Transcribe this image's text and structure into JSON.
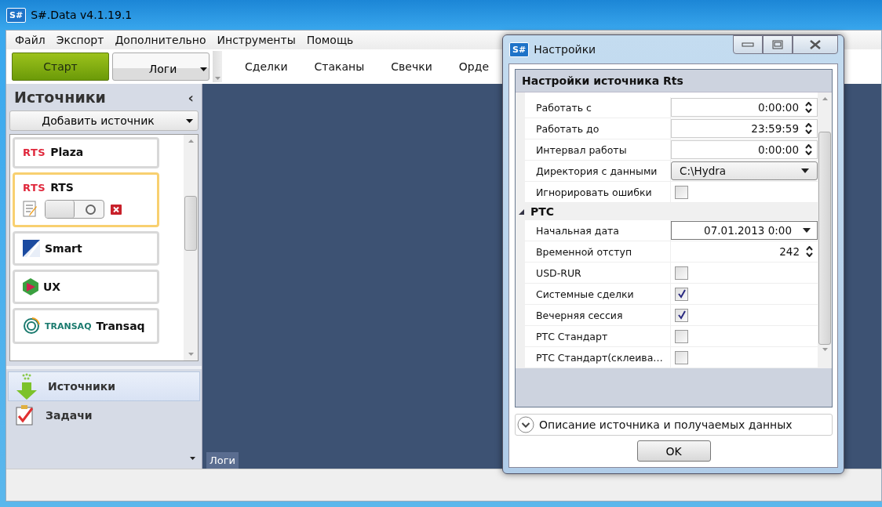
{
  "window": {
    "logo": "S#",
    "title": "S#.Data v4.1.19.1"
  },
  "menu": [
    "Файл",
    "Экспорт",
    "Дополнительно",
    "Инструменты",
    "Помощь"
  ],
  "toolbar": {
    "start_button": "Старт",
    "logs_dropdown": "Логи",
    "tabs": [
      "Сделки",
      "Стаканы",
      "Свечки",
      "Орде"
    ]
  },
  "sidebar": {
    "title": "Источники",
    "collapse_glyph": "‹",
    "add_button": "Добавить источник",
    "sources": [
      {
        "kind": "rts",
        "logo_text": "RTS",
        "name": "Plaza",
        "selected": false
      },
      {
        "kind": "rts",
        "logo_text": "RTS",
        "name": "RTS",
        "selected": true
      },
      {
        "kind": "smart",
        "name": "Smart",
        "selected": false
      },
      {
        "kind": "ux",
        "name": "UX",
        "selected": false
      },
      {
        "kind": "transaq",
        "logo_text": "TRANSAQ",
        "name": "Transaq",
        "selected": false
      }
    ],
    "selected_controls": {
      "toggle_on": false
    },
    "nav": [
      {
        "label": "Источники",
        "selected": true
      },
      {
        "label": "Задачи",
        "selected": false
      }
    ]
  },
  "main": {
    "bottom_tab": "Логи"
  },
  "dialog": {
    "logo": "S#",
    "title": "Настройки",
    "header": "Настройки источника Rts",
    "groups": [
      {
        "rows": [
          {
            "kind": "spin",
            "label": "Работать с",
            "value": "0:00:00"
          },
          {
            "kind": "spin",
            "label": "Работать до",
            "value": "23:59:59"
          },
          {
            "kind": "spin",
            "label": "Интервал работы",
            "value": "0:00:00"
          },
          {
            "kind": "combo",
            "label": "Директория с данными",
            "value": "C:\\Hydra"
          },
          {
            "kind": "check",
            "label": "Игнорировать ошибки",
            "checked": false
          }
        ]
      },
      {
        "title": "РТС",
        "expanded": true,
        "rows": [
          {
            "kind": "date",
            "label": "Начальная дата",
            "value": "07.01.2013 0:00"
          },
          {
            "kind": "number",
            "label": "Временной отступ",
            "value": "242"
          },
          {
            "kind": "check",
            "label": "USD-RUR",
            "checked": false
          },
          {
            "kind": "check",
            "label": "Системные сделки",
            "checked": true
          },
          {
            "kind": "check",
            "label": "Вечерняя сессия",
            "checked": true
          },
          {
            "kind": "check",
            "label": "РТС Стандарт",
            "checked": false
          },
          {
            "kind": "check",
            "label": "РТС Стандарт(склеива…",
            "checked": false
          }
        ]
      }
    ],
    "description": "Описание источника и получаемых данных",
    "ok_button": "OK"
  }
}
